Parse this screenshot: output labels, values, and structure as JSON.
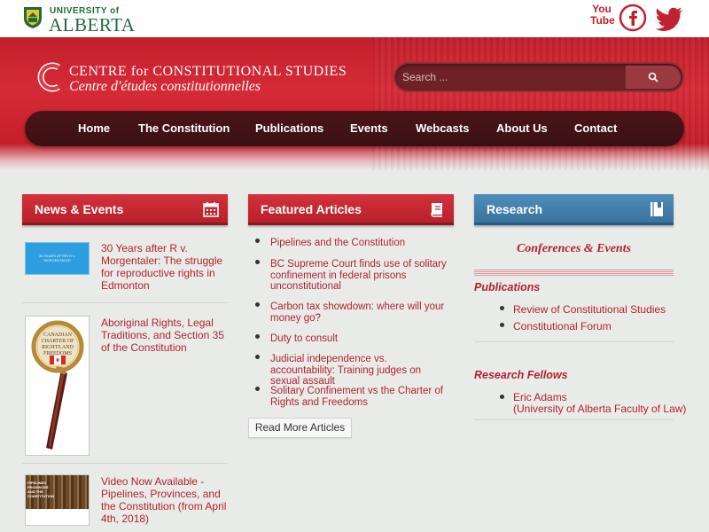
{
  "header": {
    "univ_line1": "UNIVERSITY of",
    "univ_line2": "ALBERTA",
    "youtube_line1": "You",
    "youtube_line2": "Tube"
  },
  "banner": {
    "title": "CENTRE for CONSTITUTIONAL STUDIES",
    "subtitle": "Centre d'études constitutionnelles"
  },
  "search": {
    "placeholder": "Search ..."
  },
  "nav": {
    "items": [
      "Home",
      "The Constitution",
      "Publications",
      "Events",
      "Webcasts",
      "About Us",
      "Contact"
    ]
  },
  "news": {
    "heading": "News & Events",
    "items": [
      {
        "title": "30 Years after R v. Morgentaler: The struggle for reproductive rights in Edmonton",
        "thumb_text": "30 YEARS AFTER R v. MORGENTALER"
      },
      {
        "title": "Aboriginal Rights, Legal Traditions, and Section 35 of the Constitution",
        "thumb_text": "CANADIAN CHARTER OF RIGHTS AND FREEDOMS"
      },
      {
        "title": "Video Now Available - Pipelines, Provinces, and the Constitution (from April 4th, 2018)",
        "thumb_text": "PIPELINES PROVINCES AND THE CONSTITUTION"
      }
    ]
  },
  "featured": {
    "heading": "Featured Articles",
    "items": [
      "Pipelines and the Constitution",
      "BC Supreme Court finds use of solitary confinement in federal prisons unconstitutional",
      "Carbon tax showdown: where will your money go?",
      "Duty to consult",
      "Judicial independence vs. accountability: Training judges on sexual assault",
      "Solitary Confinement vs the Charter of Rights and Freedoms"
    ],
    "read_more": "Read More Articles"
  },
  "research": {
    "heading": "Research",
    "conferences": "Conferences & Events",
    "publications_title": "Publications",
    "publications": [
      "Review of Constitutional Studies",
      "Constitutional Forum"
    ],
    "fellows_title": "Research Fellows",
    "fellows": [
      {
        "name": "Eric Adams",
        "affiliation": "(University of Alberta Faculty of Law)"
      }
    ]
  }
}
